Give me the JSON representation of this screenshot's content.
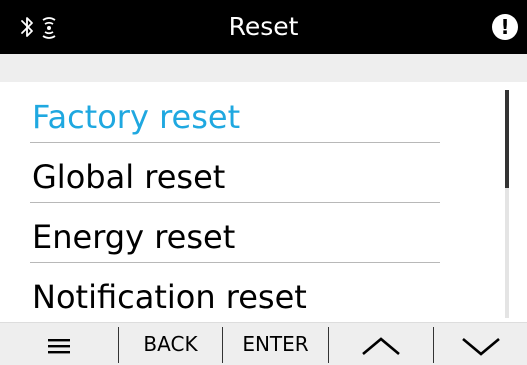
{
  "header": {
    "title": "Reset",
    "left_icons": [
      "bluetooth-icon",
      "wireless-signal-icon"
    ],
    "right_icon": "alert-icon",
    "alert_symbol": "!"
  },
  "menu": {
    "items": [
      {
        "label": "Factory reset",
        "selected": true
      },
      {
        "label": "Global reset",
        "selected": false
      },
      {
        "label": "Energy reset",
        "selected": false
      },
      {
        "label": "Notification reset",
        "selected": false
      }
    ],
    "accent_color": "#1fa8e0"
  },
  "softkeys": {
    "menu_icon": "hamburger-menu-icon",
    "back_label": "BACK",
    "enter_label": "ENTER",
    "up_icon": "chevron-up-icon",
    "down_icon": "chevron-down-icon"
  }
}
